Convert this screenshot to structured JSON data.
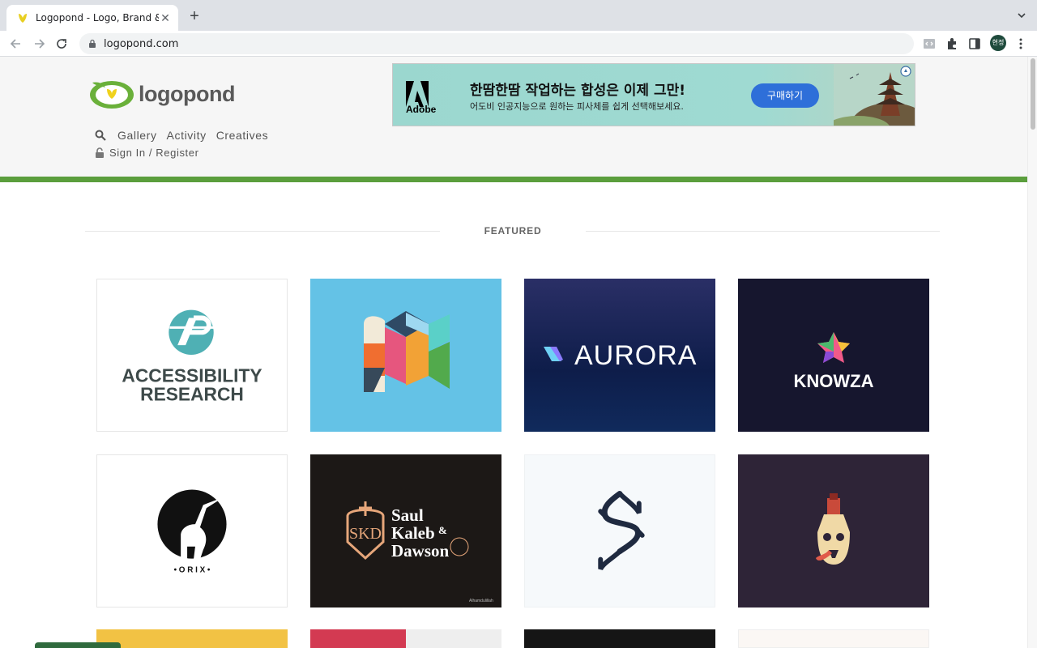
{
  "browser": {
    "tab_title": "Logopond - Logo, Brand & Ider",
    "url": "logopond.com",
    "profile_initials": "현정"
  },
  "site": {
    "logo_text": "logopond",
    "nav": [
      "Gallery",
      "Activity",
      "Creatives"
    ],
    "signin": "Sign In / Register",
    "featured_label": "FEATURED"
  },
  "ad": {
    "brand": "Adobe",
    "title": "한땀한땀 작업하는 합성은 이제 그만!",
    "subtitle": "어도비 인공지능으로 원하는 피사체를 쉽게 선택해보세요.",
    "button": "구매하기"
  },
  "cards": [
    {
      "name": "accessibility-research",
      "line1": "ACCESSIBILITY",
      "line2": "RESEARCH"
    },
    {
      "name": "colorful-m",
      "line1": "",
      "line2": ""
    },
    {
      "name": "aurora",
      "line1": "AURORA",
      "line2": ""
    },
    {
      "name": "knowza",
      "line1": "KNOWZA",
      "line2": ""
    },
    {
      "name": "orix",
      "line1": "• O R I X •",
      "line2": ""
    },
    {
      "name": "saul-kaleb-dawson",
      "line1": "Saul",
      "line2": "Kaleb",
      "line3": "Dawson",
      "amp": "&",
      "footer": "Alhamdulillah"
    },
    {
      "name": "s-monogram",
      "line1": "",
      "line2": ""
    },
    {
      "name": "skull-bottle",
      "line1": "",
      "line2": ""
    }
  ]
}
